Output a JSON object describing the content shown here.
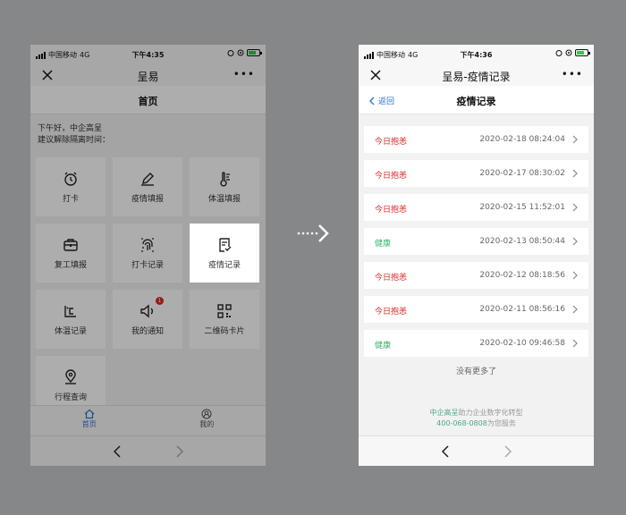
{
  "colors": {
    "accent": "#2b72d6",
    "red_status": "#d92a2a",
    "green_status": "#39b26f"
  },
  "left_screen": {
    "status": {
      "carrier": "中国移动",
      "network": "4G",
      "time": "下午4:35"
    },
    "nav": {
      "title": "呈易",
      "more": "•••"
    },
    "page_title": "首页",
    "greeting": {
      "line1": "下午好，中企高呈",
      "line2": "建议解除隔离时间："
    },
    "tiles": [
      {
        "label": "打卡",
        "icon": "alarm-clock-icon"
      },
      {
        "label": "疫情填报",
        "icon": "pencil-icon"
      },
      {
        "label": "体温填报",
        "icon": "thermometer-icon"
      },
      {
        "label": "复工填报",
        "icon": "briefcase-icon"
      },
      {
        "label": "打卡记录",
        "icon": "fingerprint-icon"
      },
      {
        "label": "疫情记录",
        "icon": "document-check-icon"
      },
      {
        "label": "体温记录",
        "icon": "temperature-celsius-icon"
      },
      {
        "label": "我的通知",
        "icon": "speaker-icon",
        "badge": "1"
      },
      {
        "label": "二维码卡片",
        "icon": "qr-code-icon"
      },
      {
        "label": "行程查询",
        "icon": "location-pin-icon"
      }
    ],
    "tabs": [
      {
        "label": "首页",
        "icon": "home-icon"
      },
      {
        "label": "我的",
        "icon": "user-icon"
      }
    ]
  },
  "right_screen": {
    "status": {
      "carrier": "中国移动",
      "network": "4G",
      "time": "下午4:36"
    },
    "nav": {
      "title": "呈易-疫情记录",
      "more": "•••"
    },
    "back_label": "返回",
    "page_title": "疫情记录",
    "records": [
      {
        "status": "今日抱恙",
        "time": "2020-02-18 08:24:04",
        "type": "red"
      },
      {
        "status": "今日抱恙",
        "time": "2020-02-17 08:30:02",
        "type": "red"
      },
      {
        "status": "今日抱恙",
        "time": "2020-02-15 11:52:01",
        "type": "red"
      },
      {
        "status": "健康",
        "time": "2020-02-13 08:50:44",
        "type": "green"
      },
      {
        "status": "今日抱恙",
        "time": "2020-02-12 08:18:56",
        "type": "red"
      },
      {
        "status": "今日抱恙",
        "time": "2020-02-11 08:56:16",
        "type": "red"
      },
      {
        "status": "健康",
        "time": "2020-02-10 09:46:58",
        "type": "green"
      }
    ],
    "no_more": "没有更多了",
    "footer": {
      "line1_brand": "中企高呈",
      "line1_rest": "助力企业数字化转型",
      "line2_phone": "400-068-0808",
      "line2_rest": "为您服务"
    }
  }
}
